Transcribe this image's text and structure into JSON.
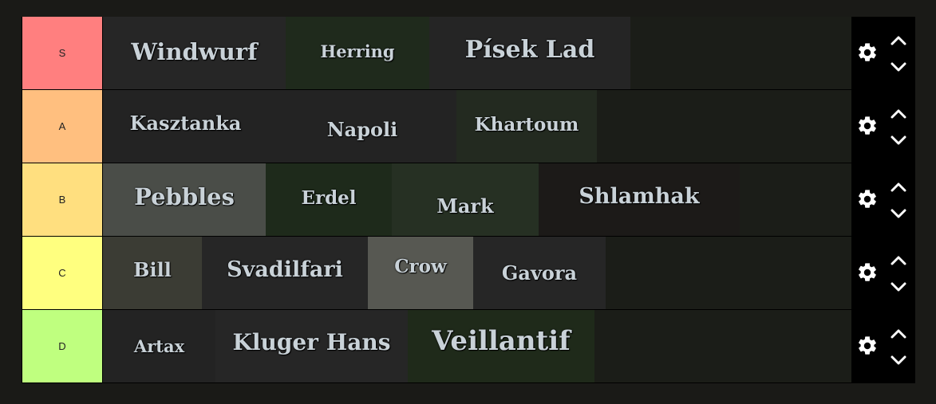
{
  "tiers": [
    {
      "label": "S",
      "color": "#ff7f7f",
      "items": [
        {
          "name": "Windwurf",
          "bg": "#262626"
        },
        {
          "name": "Herring",
          "bg": "#1f2a1c"
        },
        {
          "name": "Písek Lad",
          "bg": "#252525"
        }
      ]
    },
    {
      "label": "A",
      "color": "#ffbf7f",
      "items": [
        {
          "name": "Kasztanka",
          "bg": "#232323"
        },
        {
          "name": "Napoli",
          "bg": "#232323"
        },
        {
          "name": "Khartoum",
          "bg": "#232a20"
        }
      ]
    },
    {
      "label": "B",
      "color": "#ffdf7f",
      "items": [
        {
          "name": "Pebbles",
          "bg": "#4a4d48"
        },
        {
          "name": "Erdel",
          "bg": "#1e2a1b"
        },
        {
          "name": "Mark",
          "bg": "#263023"
        },
        {
          "name": "Shlamhak",
          "bg": "#1c1a18"
        }
      ]
    },
    {
      "label": "C",
      "color": "#ffff7f",
      "items": [
        {
          "name": "Bill",
          "bg": "#3b3c34"
        },
        {
          "name": "Svadilfari",
          "bg": "#262626"
        },
        {
          "name": "Crow",
          "bg": "#575852"
        },
        {
          "name": "Gavora",
          "bg": "#262626"
        }
      ]
    },
    {
      "label": "D",
      "color": "#bfff7f",
      "items": [
        {
          "name": "Artax",
          "bg": "#232323"
        },
        {
          "name": "Kluger Hans",
          "bg": "#262626"
        },
        {
          "name": "Veillantif",
          "bg": "#1f2a1a"
        }
      ]
    }
  ],
  "controls": {
    "settings_icon": "gear-icon",
    "up_icon": "chevron-up-icon",
    "down_icon": "chevron-down-icon",
    "icon_color": "#ffffff"
  }
}
